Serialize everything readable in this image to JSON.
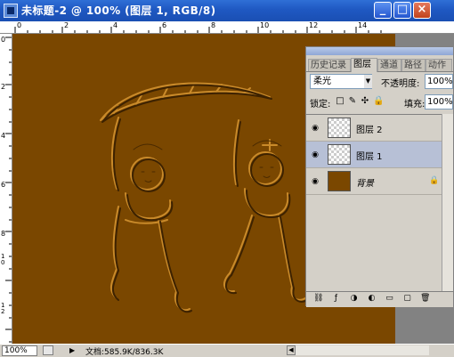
{
  "window": {
    "title": "未标题-2 @ 100% (图层 1, RGB/8)",
    "minimize": "_",
    "maximize": "□",
    "close": "×"
  },
  "rulers": {
    "top": [
      "0",
      "2",
      "4",
      "6",
      "8",
      "10",
      "12",
      "14"
    ],
    "left": [
      "0",
      "2",
      "4",
      "6",
      "8",
      "1 0",
      "1 2"
    ]
  },
  "canvas": {
    "fill_color": "#7a4700"
  },
  "status_bar": {
    "zoom": "100%",
    "doc_info": "文档:585.9K/836.3K",
    "arrow": "▶",
    "scroll_left": "◀"
  },
  "layers_panel": {
    "menu_button": "▸",
    "tabs": [
      {
        "label": "历史记录",
        "active": false
      },
      {
        "label": "图层",
        "active": true
      },
      {
        "label": "通道",
        "active": false
      },
      {
        "label": "路径",
        "active": false
      },
      {
        "label": "动作",
        "active": false
      }
    ],
    "blend_mode": "柔光",
    "blend_arrow": "▼",
    "opacity_label": "不透明度:",
    "opacity_value": "100%",
    "lock_label": "锁定:",
    "lock_icons": [
      "□",
      "✎",
      "✣",
      "🔒"
    ],
    "fill_label": "填充:",
    "fill_value": "100%",
    "layers": [
      {
        "name": "图层 2",
        "visible": true,
        "selected": false,
        "thumb": "checker"
      },
      {
        "name": "图层 1",
        "visible": true,
        "selected": true,
        "thumb": "checker"
      },
      {
        "name": "背景",
        "visible": true,
        "selected": false,
        "thumb": "solid",
        "locked": true
      }
    ],
    "eye_glyph": "◉",
    "lock_glyph": "🔒",
    "footer_icons": [
      "⛓",
      "ƒ",
      "◑",
      "◐",
      "▭",
      "▢",
      "🗑"
    ]
  }
}
